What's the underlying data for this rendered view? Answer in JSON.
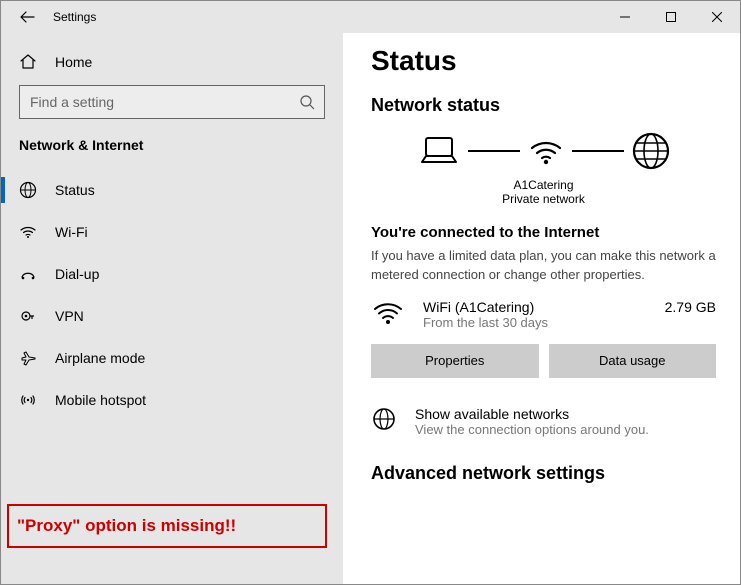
{
  "titlebar": {
    "app_name": "Settings"
  },
  "sidebar": {
    "home_label": "Home",
    "search_placeholder": "Find a setting",
    "section": "Network & Internet",
    "items": [
      {
        "label": "Status"
      },
      {
        "label": "Wi-Fi"
      },
      {
        "label": "Dial-up"
      },
      {
        "label": "VPN"
      },
      {
        "label": "Airplane mode"
      },
      {
        "label": "Mobile hotspot"
      }
    ],
    "annotation": "\"Proxy\" option is missing!!"
  },
  "main": {
    "page_title": "Status",
    "status_heading": "Network status",
    "diagram": {
      "network_name": "A1Catering",
      "network_type": "Private network"
    },
    "connected_title": "You're connected to the Internet",
    "connected_desc": "If you have a limited data plan, you can make this network a metered connection or change other properties.",
    "wifi": {
      "name": "WiFi (A1Catering)",
      "sub": "From the last 30 days",
      "usage": "2.79 GB"
    },
    "buttons": {
      "properties": "Properties",
      "data_usage": "Data usage"
    },
    "available": {
      "title": "Show available networks",
      "sub": "View the connection options around you."
    },
    "advanced_heading": "Advanced network settings"
  }
}
